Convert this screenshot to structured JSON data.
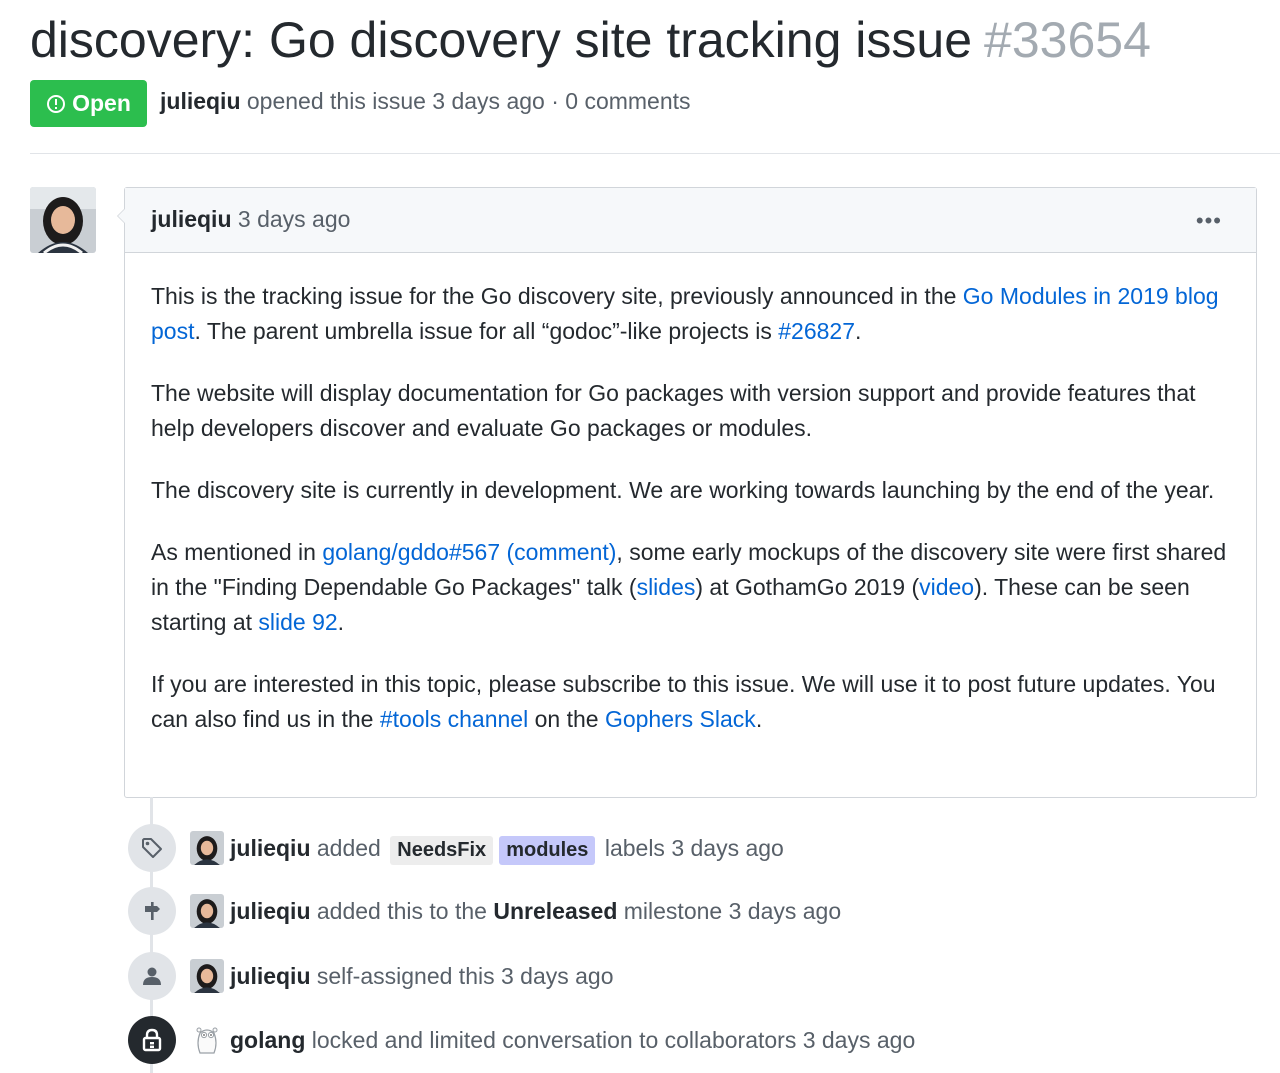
{
  "issue": {
    "title": "discovery: Go discovery site tracking issue",
    "number": "#33654",
    "state": "Open",
    "author": "julieqiu",
    "meta_rest": "opened this issue 3 days ago · 0 comments"
  },
  "comment": {
    "author": "julieqiu",
    "time": "3 days ago",
    "menu": "•••",
    "p1_a": "This is the tracking issue for the Go discovery site, previously announced in the ",
    "p1_link1": "Go Modules in 2019 blog post",
    "p1_b": ". The parent umbrella issue for all “godoc”-like projects is ",
    "p1_link2": "#26827",
    "p1_c": ".",
    "p2": "The website will display documentation for Go packages with version support and provide features that help developers discover and evaluate Go packages or modules.",
    "p3": "The discovery site is currently in development. We are working towards launching by the end of the year.",
    "p4_a": "As mentioned in ",
    "p4_link1": "golang/gddo#567 (comment)",
    "p4_b": ", some early mockups of the discovery site were first shared in the \"Finding Dependable Go Packages\" talk (",
    "p4_link2": "slides",
    "p4_c": ") at GothamGo 2019 (",
    "p4_link3": "video",
    "p4_d": "). These can be seen starting at ",
    "p4_link4": "slide 92",
    "p4_e": ".",
    "p5_a": "If you are interested in this topic, please subscribe to this issue. We will use it to post future updates. You can also find us in the ",
    "p5_link1": "#tools channel",
    "p5_b": " on the ",
    "p5_link2": "Gophers Slack",
    "p5_c": "."
  },
  "timeline": {
    "e1": {
      "actor": "julieqiu",
      "verb": "added",
      "label1": "NeedsFix",
      "label2": "modules",
      "rest": "labels 3 days ago",
      "label1_color": "#ededed",
      "label2_color": "#c5c8fa"
    },
    "e2": {
      "actor": "julieqiu",
      "pre": "added this to the",
      "milestone": "Unreleased",
      "rest": "milestone 3 days ago"
    },
    "e3": {
      "actor": "julieqiu",
      "rest": "self-assigned this 3 days ago"
    },
    "e4": {
      "actor": "golang",
      "rest": "locked and limited conversation to collaborators 3 days ago"
    }
  }
}
